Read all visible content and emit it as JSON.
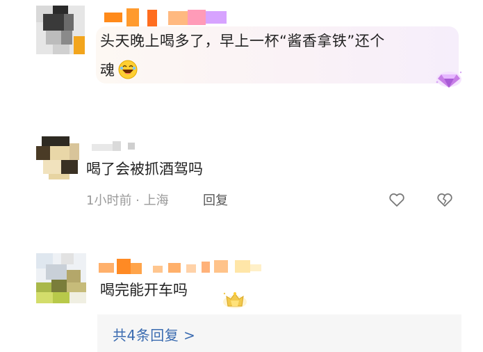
{
  "comments": [
    {
      "text_line1": "头天晚上喝多了，早上一杯“酱香拿铁”还个",
      "text_line2": "魂",
      "emoji": "laughing-emoji",
      "badge": "diamond-badge-icon"
    },
    {
      "text": "喝了会被抓酒驾吗",
      "meta": "1小时前 · 上海",
      "reply_label": "回复",
      "like_icon": "heart-icon",
      "dislike_icon": "broken-heart-icon"
    },
    {
      "text": "喝完能开车吗",
      "badge": "crown-badge-icon",
      "more_replies": "共4条回复 >"
    }
  ],
  "colors": {
    "link": "#3a6bb0",
    "meta": "#9a9a9a",
    "reply_box": "#f6f6f6",
    "badge_purple": "#c77ee6",
    "badge_gold": "#f2c94c"
  }
}
